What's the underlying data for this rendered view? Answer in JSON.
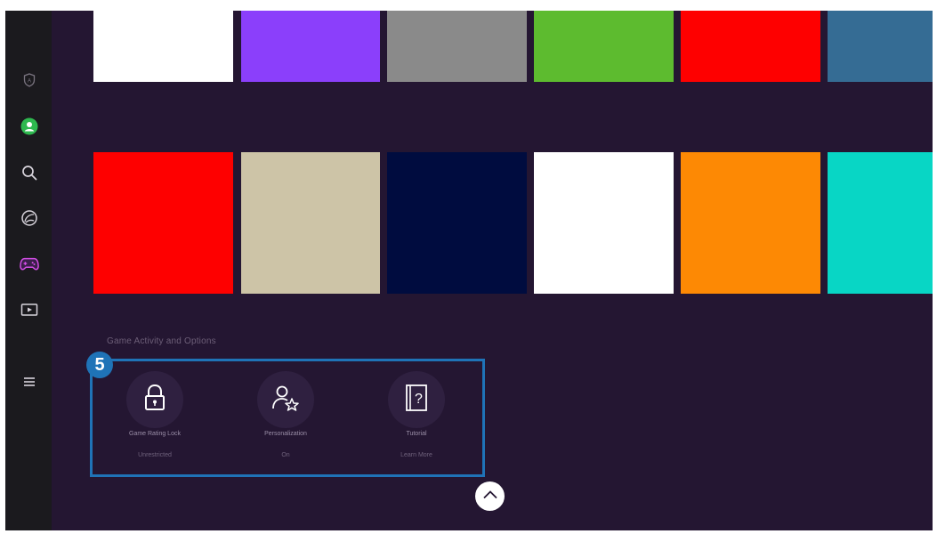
{
  "sidebar": {
    "items": [
      {
        "name": "privacy-shield",
        "icon": "shield-icon"
      },
      {
        "name": "profile",
        "icon": "user-avatar-icon",
        "accent": "#2eb84f"
      },
      {
        "name": "search",
        "icon": "search-icon"
      },
      {
        "name": "ambient",
        "icon": "ambient-icon"
      },
      {
        "name": "game",
        "icon": "gamepad-icon",
        "accent": "#d54ee8"
      },
      {
        "name": "media",
        "icon": "media-icon"
      },
      {
        "name": "menu",
        "icon": "menu-icon"
      }
    ]
  },
  "tiles": {
    "row1": [
      "#ffffff",
      "#8b3ffb",
      "#8a8a8a",
      "#5dbb2f",
      "#fe0000",
      "#356c94"
    ],
    "row2": [
      "#fe0000",
      "#cdc4a7",
      "#000c3f",
      "#ffffff",
      "#fd8904",
      "#08d6c5"
    ]
  },
  "section": {
    "title": "Game Activity and Options",
    "step_number": "5",
    "highlight_color": "#1f73b7",
    "options": [
      {
        "title": "Game Rating Lock",
        "value": "Unrestricted",
        "icon": "padlock-icon"
      },
      {
        "title": "Personalization",
        "value": "On",
        "icon": "user-star-icon"
      },
      {
        "title": "Tutorial",
        "value": "Learn More",
        "icon": "question-book-icon"
      }
    ]
  },
  "scroll": {
    "icon": "chevron-up-icon"
  }
}
